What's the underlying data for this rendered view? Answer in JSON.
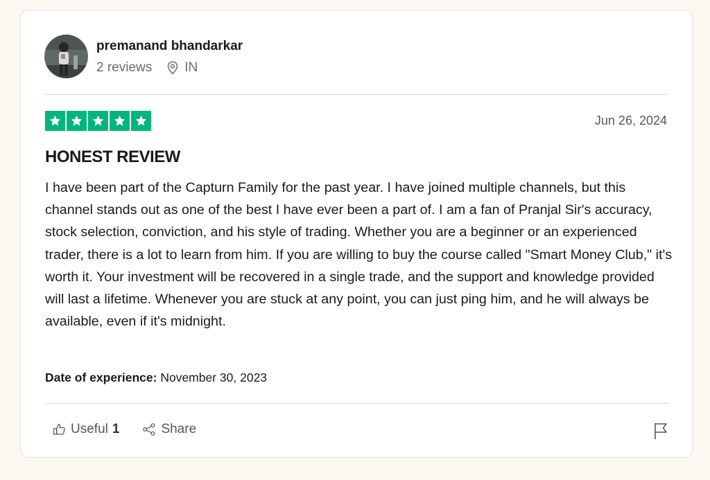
{
  "reviewer": {
    "name": "premanand bhandarkar",
    "reviews": "2 reviews",
    "country": "IN"
  },
  "review": {
    "rating": 5,
    "max_rating": 5,
    "star_color": "#00b67a",
    "date": "Jun 26, 2024",
    "title": "HONEST REVIEW",
    "body": "I have been part of the Capturn Family for the past year. I have joined multiple channels, but this channel stands out as one of the best I have ever been a part of. I am a fan of Pranjal Sir's accuracy, stock selection, conviction, and his style of trading. Whether you are a beginner or an experienced trader, there is a lot to learn from him. If you are willing to buy the course called \"Smart Money Club,\" it's worth it. Your investment will be recovered in a single trade, and the support and knowledge provided will last a lifetime. Whenever you are stuck at any point, you can just ping him, and he will always be available, even if it's midnight.",
    "experience_label": "Date of experience:",
    "experience_date": "November 30, 2023"
  },
  "actions": {
    "useful_label": "Useful",
    "useful_count": "1",
    "share_label": "Share"
  },
  "icons": {
    "location": "location-pin-icon",
    "useful": "thumbs-up-icon",
    "share": "share-icon",
    "flag": "flag-icon",
    "star": "star-icon"
  }
}
